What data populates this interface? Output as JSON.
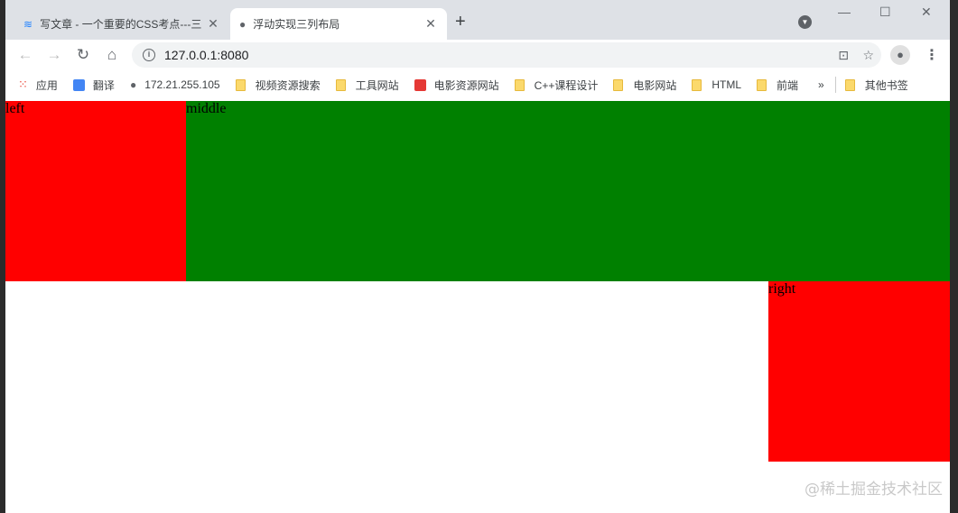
{
  "tabs": [
    {
      "label": "写文章 - 一个重要的CSS考点---三",
      "icon": "juejin-icon"
    },
    {
      "label": "浮动实现三列布局",
      "icon": "globe-icon"
    }
  ],
  "address": "127.0.0.1:8080",
  "bookmarks": [
    "应用",
    "翻译",
    "172.21.255.105",
    "视频资源搜索",
    "工具网站",
    "电影资源网站",
    "C++课程设计",
    "电影网站",
    "HTML",
    "前端"
  ],
  "other_bookmarks": "其他书签",
  "page": {
    "left": "left",
    "middle": "middle",
    "right": "right"
  },
  "colors": {
    "left": "#ff0000",
    "middle": "#008000",
    "right": "#ff0000"
  },
  "watermark": "@稀土掘金技术社区"
}
